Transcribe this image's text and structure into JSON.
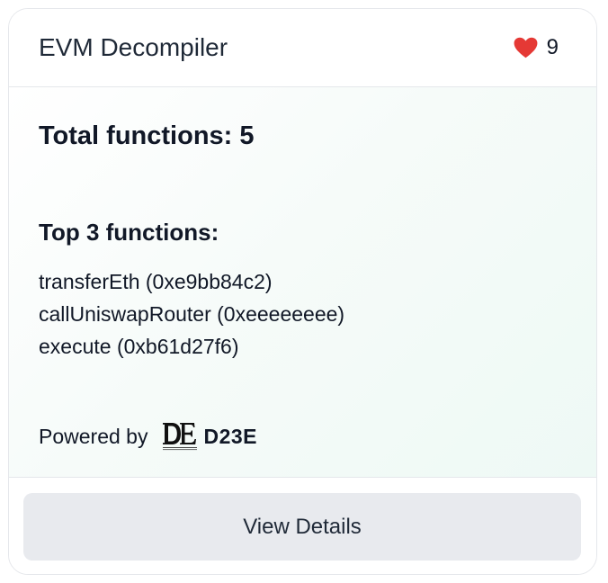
{
  "card": {
    "title": "EVM Decompiler",
    "likes": "9",
    "heart_icon": "heart-icon",
    "heart_color": "#e53935"
  },
  "body": {
    "total_label": "Total functions: ",
    "total_value": "5",
    "top_heading": "Top 3 functions:",
    "functions": [
      "transferEth (0xe9bb84c2)",
      "callUniswapRouter (0xeeeeeeee)",
      "execute (0xb61d27f6)"
    ],
    "powered_label": "Powered by",
    "brand_name": "D23E",
    "logo_icon": "d23e-logo"
  },
  "footer": {
    "button_label": "View Details"
  }
}
